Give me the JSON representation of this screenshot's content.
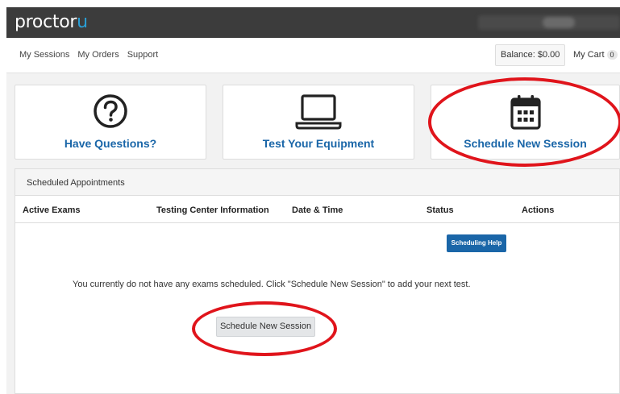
{
  "header": {
    "logo_main": "proctor",
    "logo_accent": "u"
  },
  "nav": {
    "links": [
      "My Sessions",
      "My Orders",
      "Support"
    ],
    "balance": "Balance: $0.00",
    "cart_label": "My Cart",
    "cart_count": "0"
  },
  "cards": [
    {
      "label": "Have Questions?",
      "icon": "question-circle-icon"
    },
    {
      "label": "Test Your Equipment",
      "icon": "laptop-icon"
    },
    {
      "label": "Schedule New Session",
      "icon": "calendar-icon"
    }
  ],
  "appointments": {
    "title": "Scheduled Appointments",
    "columns": [
      "Active Exams",
      "Testing Center Information",
      "Date & Time",
      "Status",
      "Actions"
    ],
    "help_button": "Scheduling Help",
    "empty_message": "You currently do not have any exams scheduled. Click \"Schedule New Session\" to add your next test.",
    "schedule_button": "Schedule New Session"
  },
  "colors": {
    "topbar": "#3c3c3c",
    "accent": "#1a66a8",
    "logo_accent": "#2a9fd6",
    "annotation": "#e0141b"
  }
}
